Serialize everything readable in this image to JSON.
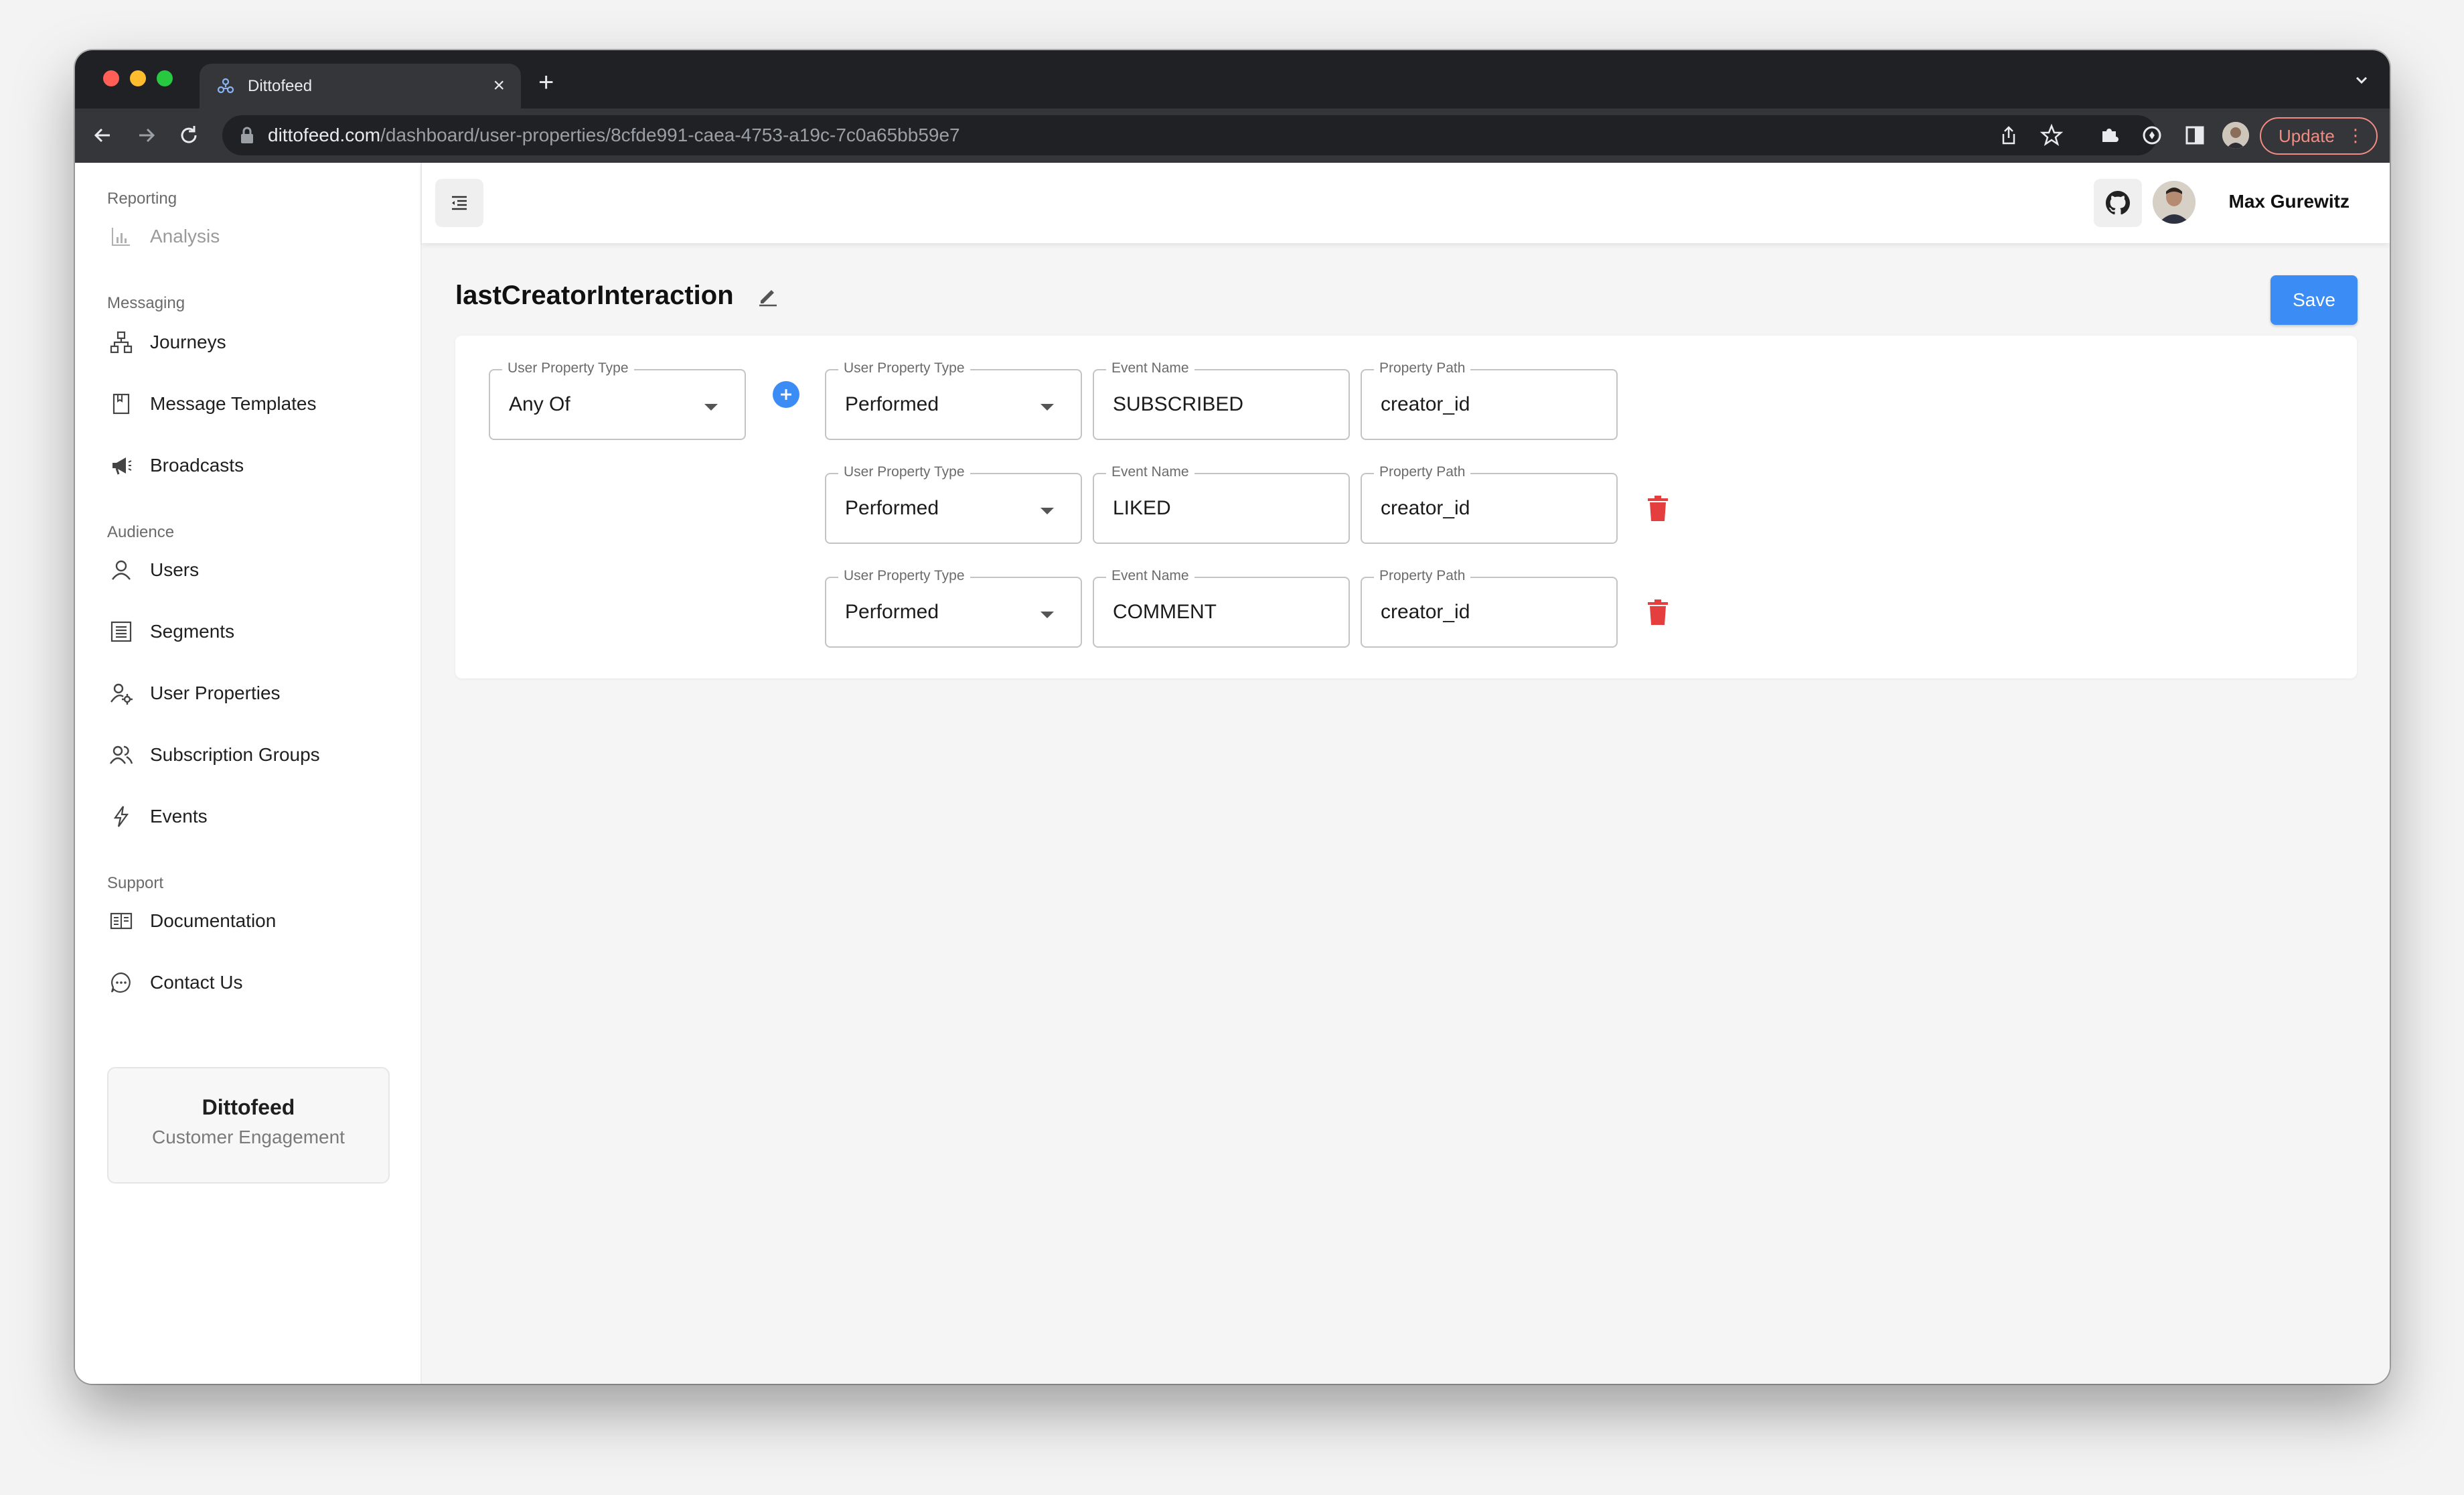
{
  "browser": {
    "tab_title": "Dittofeed",
    "url_host": "dittofeed.com",
    "url_path": "/dashboard/user-properties/8cfde991-caea-4753-a19c-7c0a65bb59e7",
    "update_label": "Update",
    "new_tab_symbol": "+",
    "close_tab_symbol": "×"
  },
  "sidebar": {
    "sections": [
      {
        "label": "Reporting",
        "items": [
          {
            "label": "Analysis",
            "icon": "chart-bar-icon",
            "disabled": true
          }
        ]
      },
      {
        "label": "Messaging",
        "items": [
          {
            "label": "Journeys",
            "icon": "sitemap-icon"
          },
          {
            "label": "Message Templates",
            "icon": "document-icon"
          },
          {
            "label": "Broadcasts",
            "icon": "megaphone-icon"
          }
        ]
      },
      {
        "label": "Audience",
        "items": [
          {
            "label": "Users",
            "icon": "user-icon"
          },
          {
            "label": "Segments",
            "icon": "segments-icon"
          },
          {
            "label": "User Properties",
            "icon": "user-settings-icon"
          },
          {
            "label": "Subscription Groups",
            "icon": "team-icon"
          },
          {
            "label": "Events",
            "icon": "lightning-icon"
          }
        ]
      },
      {
        "label": "Support",
        "items": [
          {
            "label": "Documentation",
            "icon": "book-icon"
          },
          {
            "label": "Contact Us",
            "icon": "chat-icon"
          }
        ]
      }
    ],
    "brand": {
      "title": "Dittofeed",
      "subtitle": "Customer Engagement"
    }
  },
  "header": {
    "username": "Max Gurewitz"
  },
  "page": {
    "title": "lastCreatorInteraction",
    "save_label": "Save",
    "group": {
      "label": "User Property Type",
      "value": "Any Of"
    },
    "rows": [
      {
        "type_label": "User Property Type",
        "type": "Performed",
        "event_label": "Event Name",
        "event": "SUBSCRIBED",
        "path_label": "Property Path",
        "path": "creator_id"
      },
      {
        "type_label": "User Property Type",
        "type": "Performed",
        "event_label": "Event Name",
        "event": "LIKED",
        "path_label": "Property Path",
        "path": "creator_id"
      },
      {
        "type_label": "User Property Type",
        "type": "Performed",
        "event_label": "Event Name",
        "event": "COMMENT",
        "path_label": "Property Path",
        "path": "creator_id"
      }
    ]
  },
  "colors": {
    "accent": "#3b8cf5",
    "danger": "#e53e3e"
  }
}
